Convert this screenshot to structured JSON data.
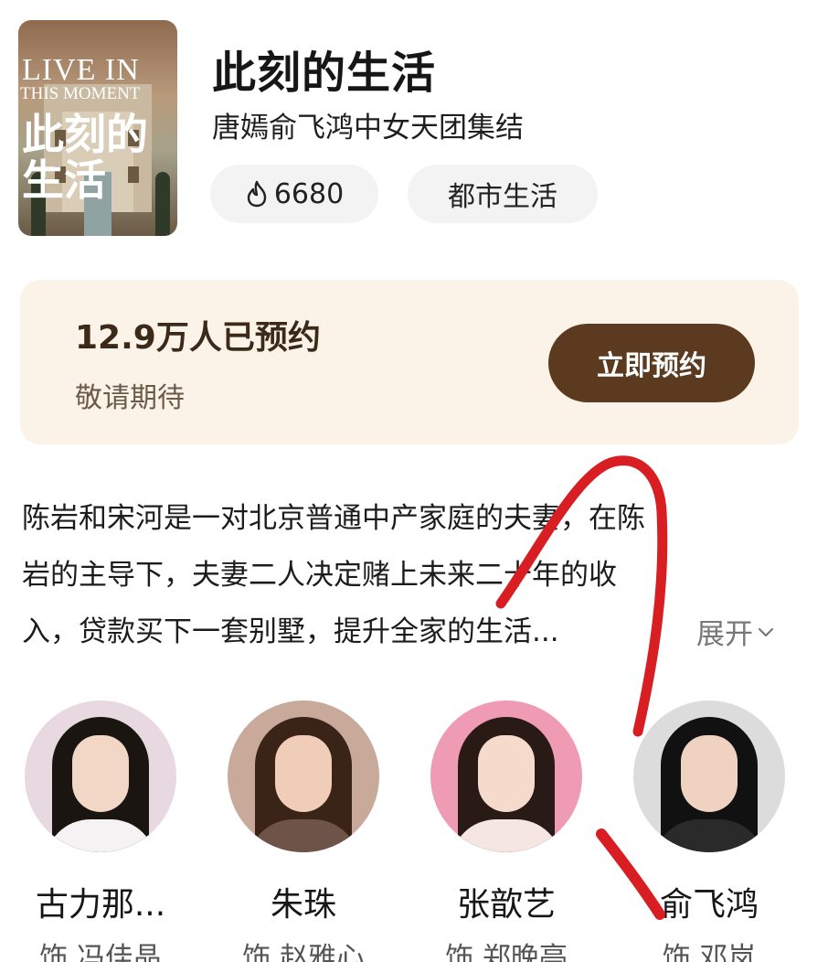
{
  "poster": {
    "title_line1": "LIVE IN",
    "title_line2": "THIS MOMENT",
    "title_cn": "此刻的生活"
  },
  "header": {
    "title": "此刻的生活",
    "subtitle": "唐嫣俞飞鸿中女天团集结",
    "heat_value": "6680",
    "heat_icon": "flame-icon",
    "genre": "都市生活"
  },
  "reservation": {
    "count_text": "12.9万人已预约",
    "sub_text": "敬请期待",
    "button_label": "立即预约",
    "button_color": "#5c3a1f",
    "card_bg": "#fbf3e7"
  },
  "synopsis": {
    "lines": [
      "陈岩和宋河是一对北京普通中产家庭的夫妻，在陈",
      "岩的主导下，夫妻二人决定赌上未来二十年的收",
      "入，贷款买下一套别墅，提升全家的生活..."
    ],
    "expand_label": "展开"
  },
  "cast": [
    {
      "name": "古力那...",
      "role": "饰 冯佳晶"
    },
    {
      "name": "朱珠",
      "role": "饰 赵雅心"
    },
    {
      "name": "张歆艺",
      "role": "饰 郑晚亭"
    },
    {
      "name": "俞飞鸿",
      "role": "饰 邓岚"
    }
  ],
  "annotation_color": "#d81e22"
}
